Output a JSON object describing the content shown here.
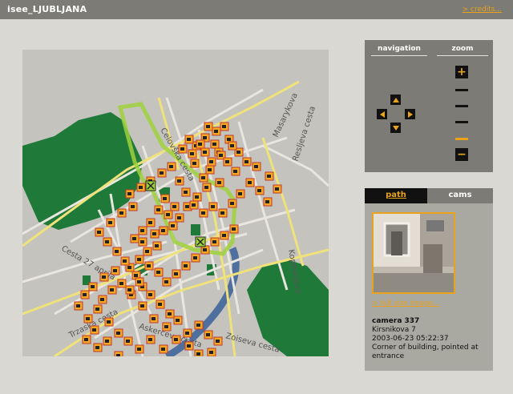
{
  "header": {
    "title": "isee_LJUBLJANA",
    "credits_link": "> credits..."
  },
  "map": {
    "streets": [
      {
        "label": "Celovška cesta"
      },
      {
        "label": "Masarykova"
      },
      {
        "label": "Resljeva cesta"
      },
      {
        "label": "Cesta 27 aprila"
      },
      {
        "label": "Kopitarjeva"
      },
      {
        "label": "Trzaska cesta"
      },
      {
        "label": "Askerceva cesta"
      },
      {
        "label": "Zoiseva cesta"
      }
    ],
    "colors": {
      "background": "#c4c3bd",
      "park": "#1f7a3a",
      "road": "#e8e6df",
      "arterial": "#f0e27a",
      "river": "#4f6f9e",
      "route": "#9fd13c",
      "camera": "#f5a623"
    }
  },
  "nav": {
    "navigation_label": "navigation",
    "zoom_label": "zoom",
    "zoom_in": "+",
    "zoom_out": "−",
    "zoom_level_active": 4,
    "zoom_levels": 4
  },
  "info": {
    "tabs": {
      "path": "path",
      "cams": "cams"
    },
    "fullsize_link": "> full size image...",
    "camera": {
      "title": "camera 337",
      "address": "Kirsnikova 7",
      "timestamp": "2003-06-23 05:22:37",
      "description": "Corner of building, pointed at entrance"
    }
  }
}
